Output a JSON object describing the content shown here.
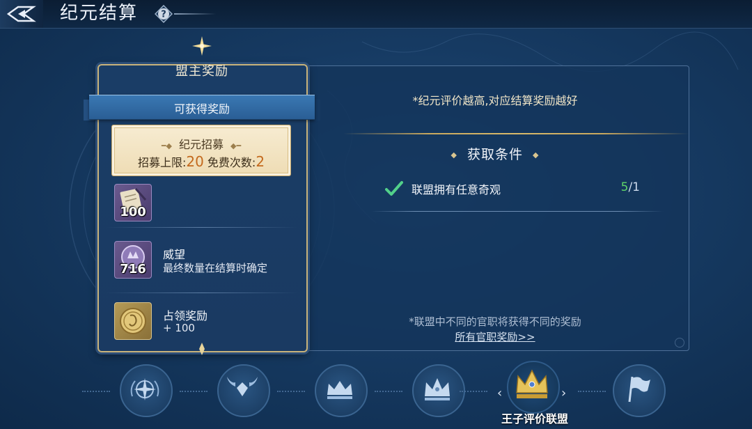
{
  "header": {
    "title": "纪元结算",
    "help_symbol": "?"
  },
  "reward_card": {
    "header_label": "盟主奖励",
    "banner_label": "可获得奖励",
    "recruit": {
      "title": "纪元招募",
      "limit_label": "招募上限:",
      "limit_value": "20",
      "free_label": "免费次数:",
      "free_value": "2"
    },
    "items": [
      {
        "icon": "scroll-quill-icon",
        "count": "100",
        "name": "",
        "desc": ""
      },
      {
        "icon": "prestige-medal-icon",
        "count": "716",
        "name": "威望",
        "desc": "最终数量在结算时确定"
      },
      {
        "icon": "gold-coin-icon",
        "count": "",
        "name": "占领奖励",
        "desc": "+ 100"
      }
    ]
  },
  "condition_panel": {
    "tip_top": "*纪元评价越高,对应结算奖励越好",
    "section_title": "获取条件",
    "conditions": [
      {
        "text": "联盟拥有任意奇观",
        "current": "5",
        "required": "/1",
        "met": true
      }
    ],
    "tip_bottom": "*联盟中不同的官职将获得不同的奖励",
    "all_rewards_link": "所有官职奖励>>"
  },
  "tabs": [
    {
      "icon": "compass-wreath-icon",
      "active": false
    },
    {
      "icon": "winged-diamond-icon",
      "active": false
    },
    {
      "icon": "crown-icon",
      "active": false
    },
    {
      "icon": "jeweled-crown-icon",
      "active": false
    },
    {
      "icon": "gold-crown-icon",
      "active": true,
      "label": "王子评价联盟"
    },
    {
      "icon": "flag-icon",
      "active": false
    }
  ],
  "colors": {
    "accent_gold": "#c9b37a",
    "progress_met": "#5fd46a",
    "ticket_number": "#c46a1e"
  }
}
